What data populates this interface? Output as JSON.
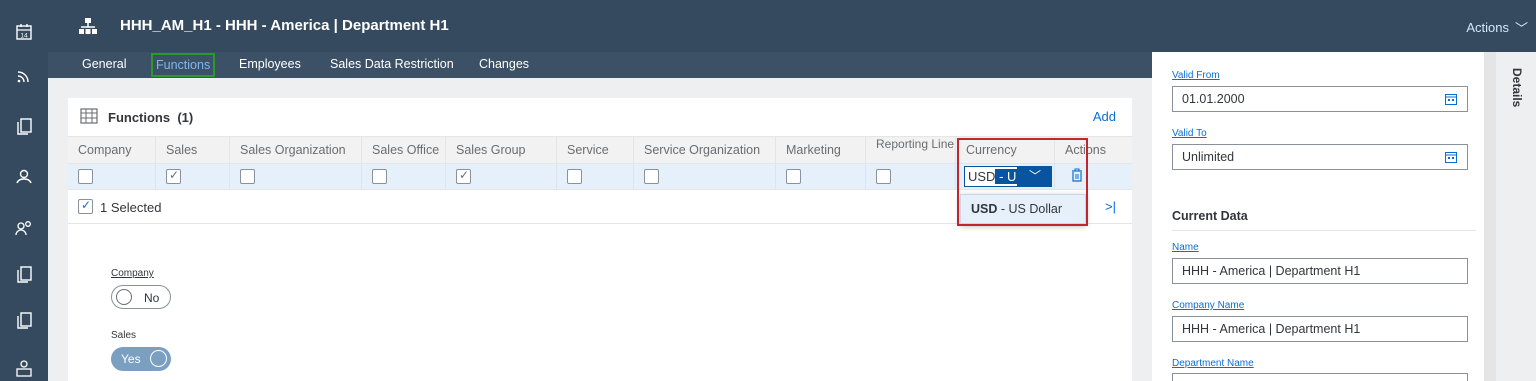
{
  "header": {
    "title": "HHH_AM_H1 - HHH - America | Department H1",
    "actions_label": "Actions"
  },
  "tabs": [
    "General",
    "Functions",
    "Employees",
    "Sales Data Restriction",
    "Changes"
  ],
  "functions": {
    "title": "Functions",
    "count": "(1)",
    "add_label": "Add",
    "columns": [
      "Company",
      "Sales",
      "Sales Organization",
      "Sales Office",
      "Sales Group",
      "Service",
      "Service Organization",
      "Marketing",
      "Reporting Line",
      "Currency",
      "Actions"
    ],
    "row": {
      "company": false,
      "sales": true,
      "sales_organization": false,
      "sales_office": false,
      "sales_group": true,
      "service": false,
      "service_organization": false,
      "marketing": false,
      "reporting_line": false,
      "currency_typed": "USD",
      "currency_selected": " - US"
    },
    "selected_text": "1 Selected",
    "last_page": ">|",
    "dropdown_option_code": "USD",
    "dropdown_option_text": " - US Dollar"
  },
  "detail_form": {
    "company_label": "Company",
    "company_value": "No",
    "sales_label": "Sales",
    "sales_value": "Yes"
  },
  "side_panel": {
    "valid_from_label": "Valid From",
    "valid_from_value": "01.01.2000",
    "valid_to_label": "Valid To",
    "valid_to_value": "Unlimited",
    "section_title": "Current Data",
    "name_label": "Name",
    "name_value": "HHH - America | Department H1",
    "company_name_label": "Company Name",
    "company_name_value": "HHH - America | Department H1",
    "department_name_label": "Department Name",
    "details_tab": "Details"
  },
  "rail_icons": [
    "calendar-icon",
    "feed-icon",
    "copy-icon",
    "settings-group-icon",
    "people-icon",
    "copy-icon",
    "copy-icon",
    "org-people-icon"
  ],
  "colors": {
    "shell": "#354a5f",
    "accent": "#0a6ed1",
    "selected_tab_outline": "#2b9a2b",
    "highlight_box": "#c0262e"
  }
}
